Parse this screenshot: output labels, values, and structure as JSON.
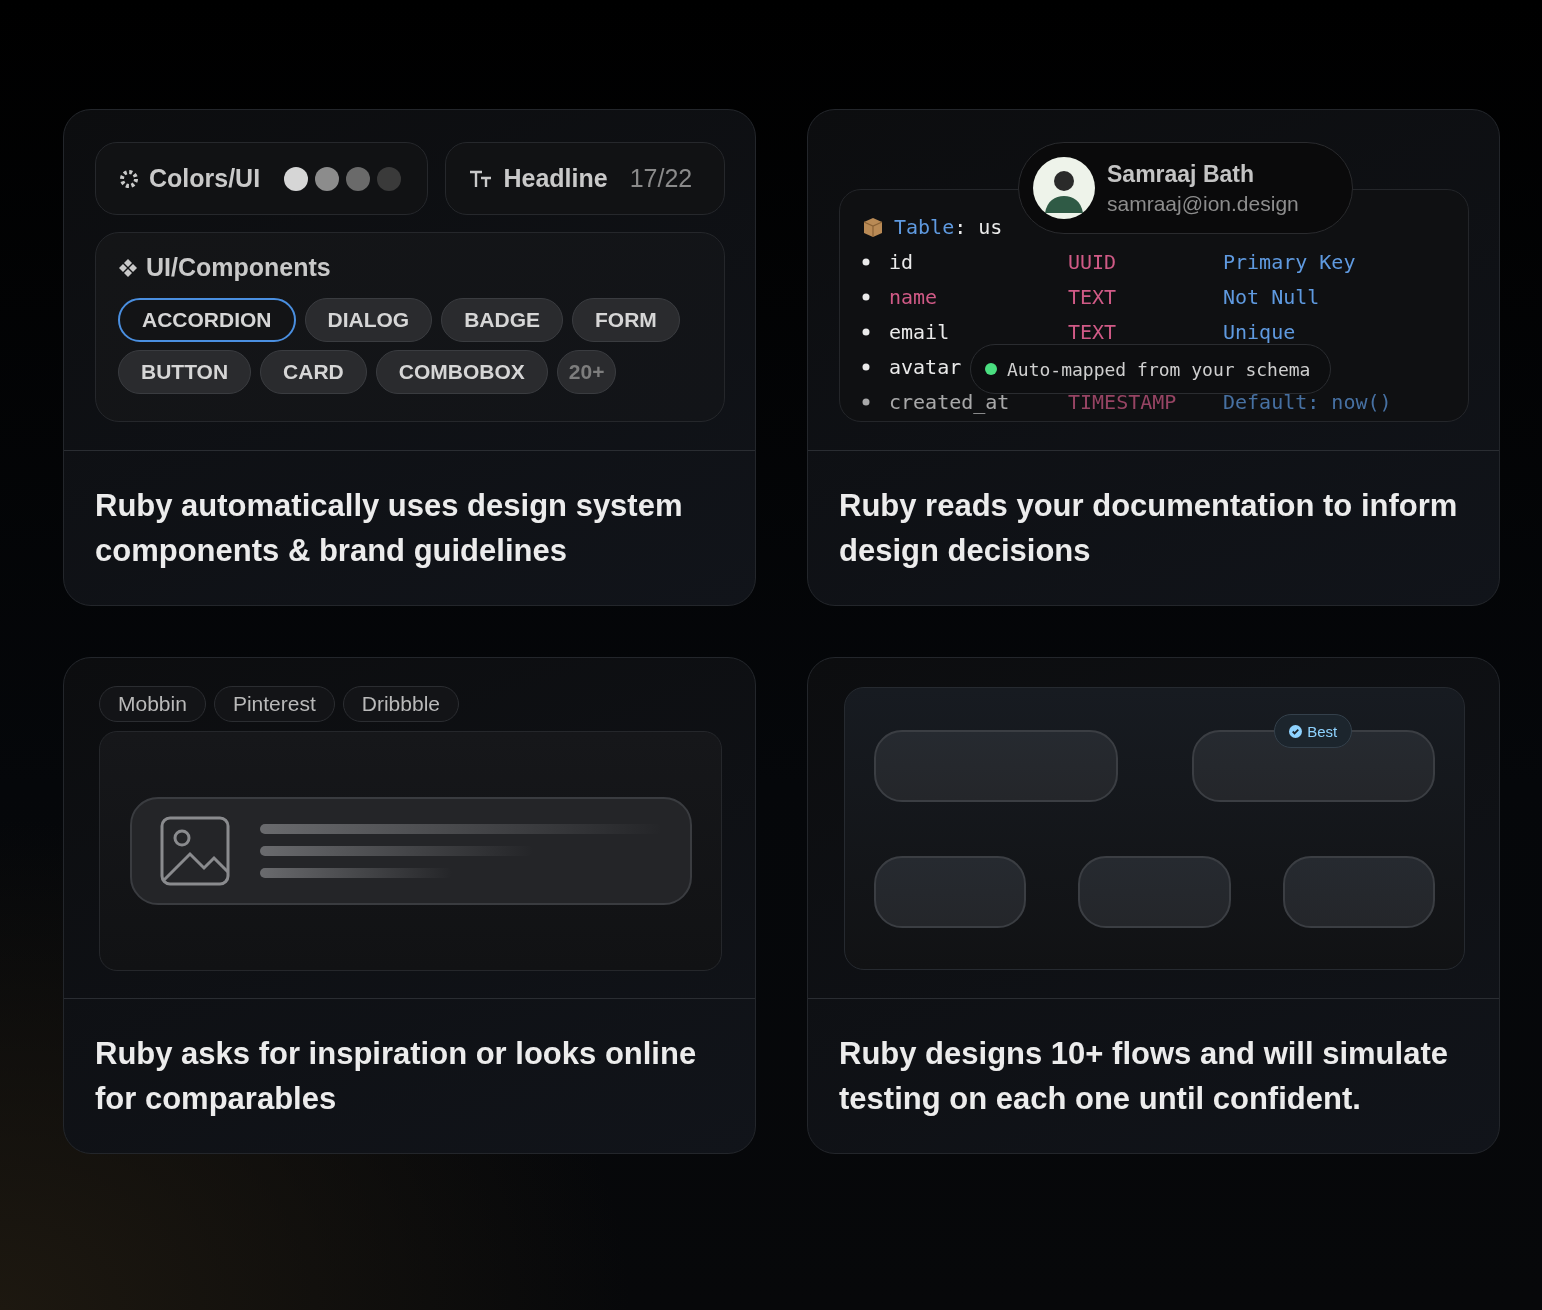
{
  "cards": [
    {
      "kind": "design-system",
      "color_token": {
        "label": "Colors/UI",
        "swatches": [
          {
            "color": "#d6d6d6"
          },
          {
            "color": "#8c8c8c"
          },
          {
            "color": "#6a6a6a"
          },
          {
            "color": "#3a3a3a"
          }
        ]
      },
      "type_token": {
        "label": "Headline",
        "size": "17/22"
      },
      "components": {
        "title": "UI/Components",
        "chips": [
          {
            "label": "ACCORDION",
            "kind": "component",
            "selected": true
          },
          {
            "label": "DIALOG",
            "kind": "component",
            "selected": false
          },
          {
            "label": "BADGE",
            "kind": "component",
            "selected": false
          },
          {
            "label": "FORM",
            "kind": "component",
            "selected": false
          },
          {
            "label": "BUTTON",
            "kind": "component",
            "selected": false
          },
          {
            "label": "CARD",
            "kind": "component",
            "selected": false
          },
          {
            "label": "COMBOBOX",
            "kind": "component",
            "selected": false
          },
          {
            "label": "20+",
            "kind": "count",
            "selected": false
          }
        ]
      },
      "caption": "Ruby automatically uses design system components & brand guidelines"
    },
    {
      "kind": "documentation",
      "profile": {
        "name": "Samraaj Bath",
        "email": "samraaj@ion.design"
      },
      "table": {
        "label": "Table",
        "name": ": us",
        "rows": [
          {
            "field": "id",
            "type": "UUID",
            "constraint": "Primary Key",
            "highlighted": false,
            "faded": false
          },
          {
            "field": "name",
            "type": "TEXT",
            "constraint": "Not Null",
            "highlighted": true,
            "faded": false
          },
          {
            "field": "email",
            "type": "TEXT",
            "constraint": "Unique",
            "highlighted": false,
            "faded": false
          },
          {
            "field": "avatar",
            "highlighted": false,
            "faded": false
          },
          {
            "field": "created_at",
            "type": "TIMESTAMP",
            "constraint": "Default: now()",
            "highlighted": false,
            "faded": true
          }
        ]
      },
      "toast": "Auto-mapped from your schema",
      "caption": "Ruby reads your documentation to inform design decisions"
    },
    {
      "kind": "inspiration",
      "sources": [
        "Mobbin",
        "Pinterest",
        "Dribbble"
      ],
      "caption": "Ruby asks for inspiration or looks online for comparables"
    },
    {
      "kind": "flows",
      "badge": "Best",
      "caption": "Ruby designs 10+ flows and will simulate testing on each one until confident."
    }
  ]
}
